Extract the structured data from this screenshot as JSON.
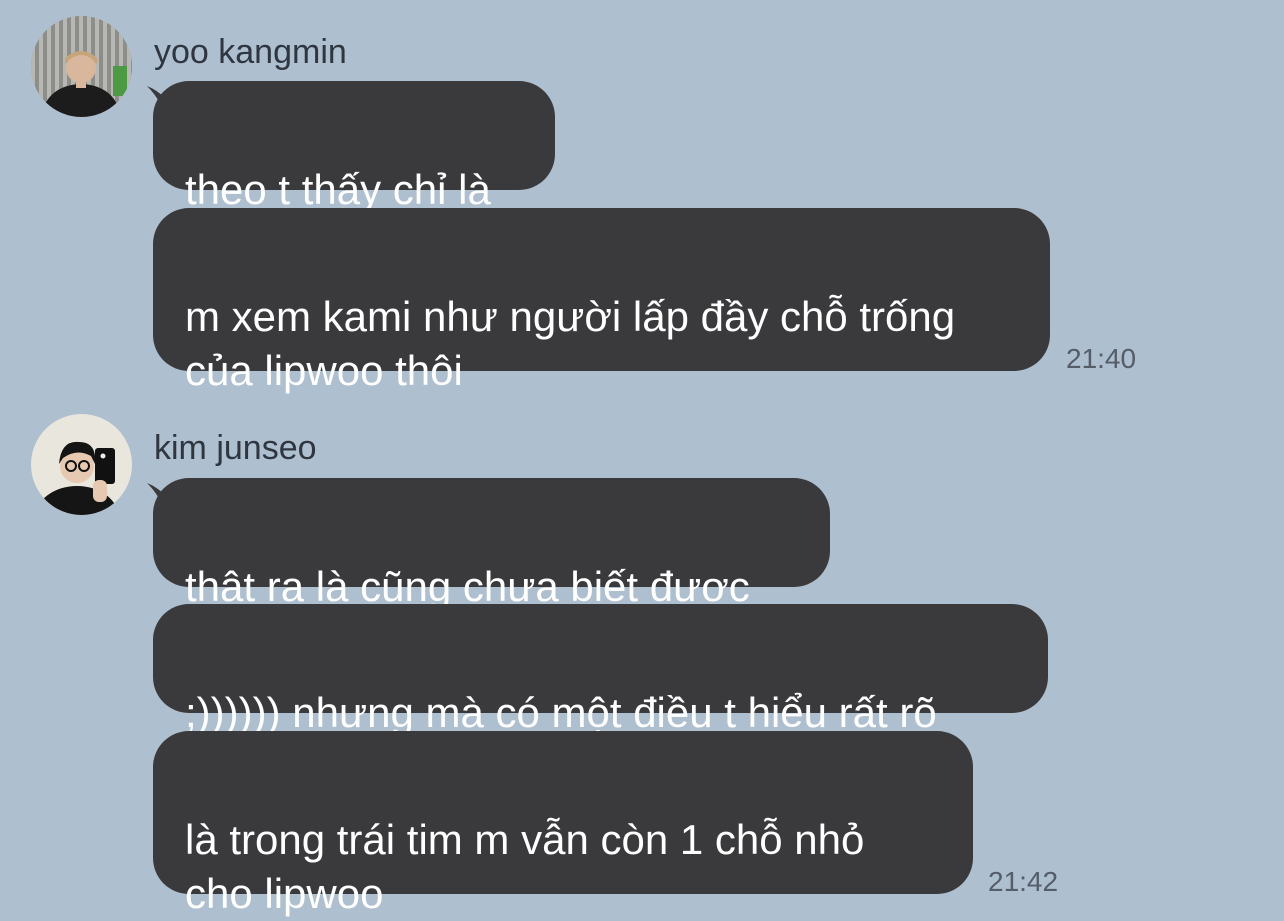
{
  "colors": {
    "background": "#aebfd0",
    "bubble": "#3a3a3c",
    "bubble_text": "#ffffff",
    "name_text": "#2f3640",
    "time_text": "#545d68"
  },
  "groups": [
    {
      "sender": "yoo kangmin",
      "avatar_icon": "user-photo-avatar",
      "messages": [
        "theo t thấy chỉ là",
        "m xem kami như người lấp đầy chỗ trống\ncủa lipwoo thôi"
      ],
      "time": "21:40"
    },
    {
      "sender": "kim junseo",
      "avatar_icon": "user-photo-avatar",
      "messages": [
        "thật ra là cũng chưa biết được",
        ";)))))) nhưng mà có một điều t hiểu rất rõ",
        "là trong trái tim m vẫn còn 1 chỗ nhỏ\ncho lipwoo"
      ],
      "time": "21:42"
    }
  ]
}
